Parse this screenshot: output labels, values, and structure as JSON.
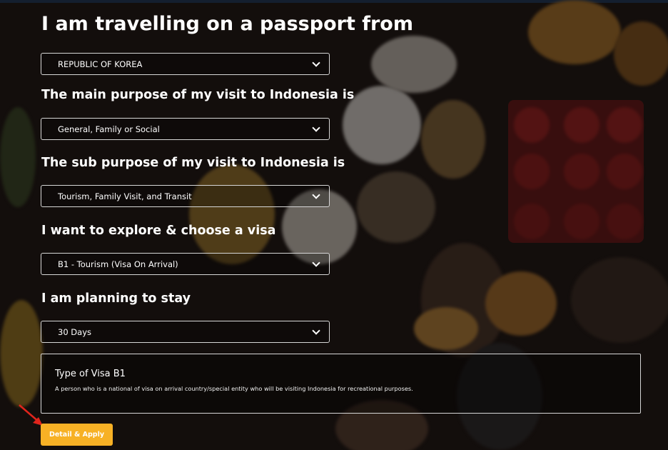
{
  "page": {
    "title": "I am travelling on a passport from",
    "accent_color": "#f7b125"
  },
  "form": {
    "passport": {
      "value": "REPUBLIC OF KOREA"
    },
    "purpose": {
      "label": "The main purpose of my visit to Indonesia is",
      "value": "General, Family or Social"
    },
    "sub_purpose": {
      "label": "The sub purpose of my visit to Indonesia is",
      "value": "Tourism, Family Visit, and Transit"
    },
    "visa": {
      "label": "I want to explore & choose a visa",
      "value": "B1 - Tourism (Visa On Arrival)"
    },
    "stay": {
      "label": "I am planning to stay",
      "value": "30 Days"
    }
  },
  "visa_info": {
    "title": "Type of Visa B1",
    "description": "A person who is a national of visa on arrival country/special entity who will be visiting Indonesia for recreational purposes."
  },
  "actions": {
    "detail_apply": "Detail & Apply"
  },
  "icons": {
    "dropdown": "chevron-down-icon",
    "annotation": "red-arrow-icon"
  }
}
